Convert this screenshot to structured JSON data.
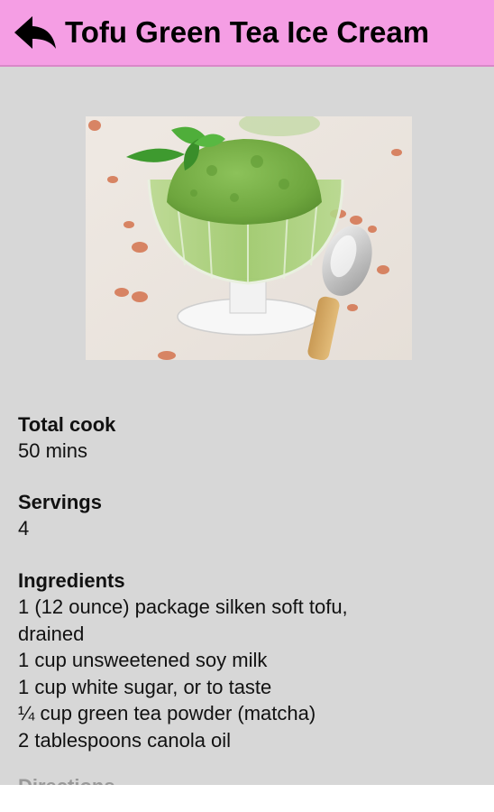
{
  "header": {
    "title": "Tofu Green Tea Ice Cream",
    "back_icon": "back-arrow-icon",
    "background_color": "#f59ee4"
  },
  "recipe": {
    "image_description_icon": "matcha-ice-cream-photo",
    "total_cook": {
      "label": "Total cook",
      "value": "50 mins"
    },
    "servings": {
      "label": "Servings",
      "value": "4"
    },
    "ingredients": {
      "label": "Ingredients",
      "items": [
        "1 (12 ounce) package silken soft tofu,",
        "drained",
        "1 cup unsweetened soy milk",
        "1 cup white sugar, or to taste",
        "¼ cup green tea powder (matcha)",
        "2 tablespoons canola oil"
      ]
    },
    "directions": {
      "label": "Directions"
    }
  }
}
